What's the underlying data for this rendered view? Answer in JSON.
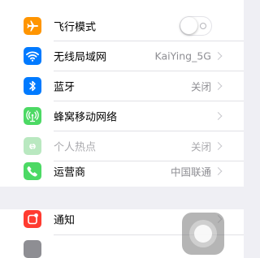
{
  "settings": {
    "airplane": {
      "label": "飞行模式",
      "toggle_on": false
    },
    "wlan": {
      "label": "无线局域网",
      "value": "KaiYing_5G"
    },
    "bluetooth": {
      "label": "蓝牙",
      "value": "关闭"
    },
    "cellular": {
      "label": "蜂窝移动网络"
    },
    "hotspot": {
      "label": "个人热点",
      "value": "关闭"
    },
    "carrier": {
      "label": "运营商",
      "value": "中国联通"
    },
    "notifications": {
      "label": "通知"
    }
  },
  "icons": {
    "airplane": "airplane-icon",
    "wlan": "wifi-icon",
    "bluetooth": "bluetooth-icon",
    "cellular": "antenna-icon",
    "hotspot": "hotspot-icon",
    "carrier": "phone-icon",
    "notifications": "notification-icon",
    "assistive_touch": "assistive-touch-button"
  },
  "colors": {
    "airplane": "#ff9500",
    "wlan": "#007aff",
    "bluetooth": "#007aff",
    "cellular": "#4cd964",
    "hotspot": "#b9e8c0",
    "carrier": "#4cd964",
    "notifications": "#ff3b30"
  }
}
